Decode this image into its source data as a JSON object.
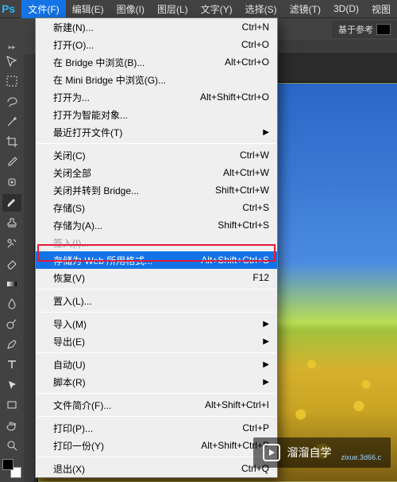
{
  "menubar": {
    "logo": "Ps",
    "items": [
      "文件(F)",
      "编辑(E)",
      "图像(I)",
      "图层(L)",
      "文字(Y)",
      "选择(S)",
      "滤镜(T)",
      "3D(D)",
      "视图"
    ]
  },
  "optionsbar": {
    "right_label": "基于参考"
  },
  "file_menu": {
    "groups": [
      [
        {
          "label": "新建(N)...",
          "shortcut": "Ctrl+N"
        },
        {
          "label": "打开(O)...",
          "shortcut": "Ctrl+O"
        },
        {
          "label": "在 Bridge 中浏览(B)...",
          "shortcut": "Alt+Ctrl+O"
        },
        {
          "label": "在 Mini Bridge 中浏览(G)..."
        },
        {
          "label": "打开为...",
          "shortcut": "Alt+Shift+Ctrl+O"
        },
        {
          "label": "打开为智能对象..."
        },
        {
          "label": "最近打开文件(T)",
          "sub": true
        }
      ],
      [
        {
          "label": "关闭(C)",
          "shortcut": "Ctrl+W"
        },
        {
          "label": "关闭全部",
          "shortcut": "Alt+Ctrl+W"
        },
        {
          "label": "关闭并转到 Bridge...",
          "shortcut": "Shift+Ctrl+W"
        },
        {
          "label": "存储(S)",
          "shortcut": "Ctrl+S"
        },
        {
          "label": "存储为(A)...",
          "shortcut": "Shift+Ctrl+S"
        },
        {
          "label": "签入(I)...",
          "disabled": true
        },
        {
          "label": "存储为 Web 所用格式...",
          "shortcut": "Alt+Shift+Ctrl+S",
          "highlight": true
        },
        {
          "label": "恢复(V)",
          "shortcut": "F12"
        }
      ],
      [
        {
          "label": "置入(L)..."
        }
      ],
      [
        {
          "label": "导入(M)",
          "sub": true
        },
        {
          "label": "导出(E)",
          "sub": true
        }
      ],
      [
        {
          "label": "自动(U)",
          "sub": true
        },
        {
          "label": "脚本(R)",
          "sub": true
        }
      ],
      [
        {
          "label": "文件简介(F)...",
          "shortcut": "Alt+Shift+Ctrl+I"
        }
      ],
      [
        {
          "label": "打印(P)...",
          "shortcut": "Ctrl+P"
        },
        {
          "label": "打印一份(Y)",
          "shortcut": "Alt+Shift+Ctrl+P"
        }
      ],
      [
        {
          "label": "退出(X)",
          "shortcut": "Ctrl+Q"
        }
      ]
    ]
  },
  "tools": [
    "move",
    "marquee",
    "lasso",
    "wand",
    "crop",
    "eyedropper",
    "healing",
    "brush",
    "stamp",
    "history-brush",
    "eraser",
    "gradient",
    "blur",
    "dodge",
    "pen",
    "type",
    "path-select",
    "rectangle",
    "hand",
    "zoom"
  ],
  "watermark": {
    "text": "溜溜自学",
    "sub": "zixue.3d66.c"
  }
}
